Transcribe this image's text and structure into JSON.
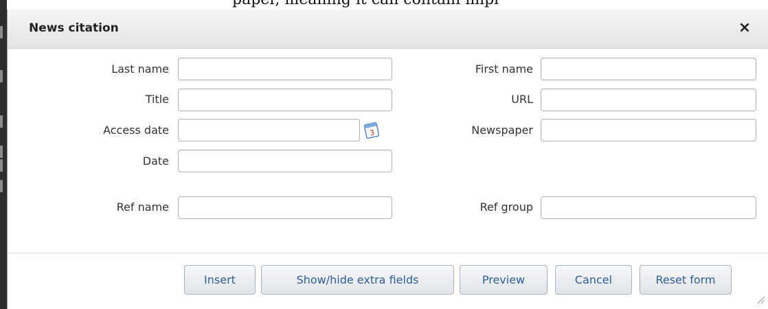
{
  "dialog": {
    "title": "News citation",
    "close_label": "×"
  },
  "fields": {
    "last_name": {
      "label": "Last name",
      "value": ""
    },
    "first_name": {
      "label": "First name",
      "value": ""
    },
    "title": {
      "label": "Title",
      "value": ""
    },
    "url": {
      "label": "URL",
      "value": ""
    },
    "access_date": {
      "label": "Access date",
      "value": ""
    },
    "newspaper": {
      "label": "Newspaper",
      "value": ""
    },
    "date": {
      "label": "Date",
      "value": ""
    },
    "ref_name": {
      "label": "Ref name",
      "value": ""
    },
    "ref_group": {
      "label": "Ref group",
      "value": ""
    }
  },
  "calendar_icon": {
    "name": "calendar-icon",
    "day": "3"
  },
  "buttons": {
    "insert": "Insert",
    "show_hide": "Show/hide extra fields",
    "preview": "Preview",
    "cancel": "Cancel",
    "reset": "Reset form"
  },
  "background_text": "paper, meaning it can contain impl"
}
